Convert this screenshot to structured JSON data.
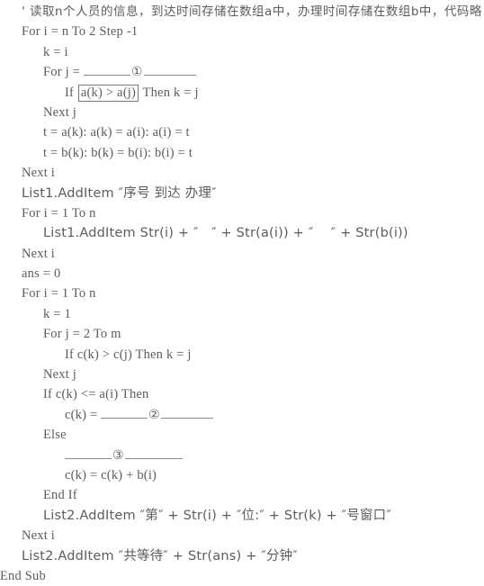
{
  "document": {
    "kind": "vb-pseudocode-listing",
    "language": "Visual Basic",
    "background_color": "#ffffff",
    "text_color": "#5c5c5c",
    "box_border_color": "#7a7a7a",
    "blank_rule_color": "#8a8a8a"
  },
  "lines": [
    {
      "id": "l1",
      "indent": 0,
      "text": "' 读取n个人员的信息，到达时间存储在数组a中，办理时间存储在数组b中，代码略"
    },
    {
      "id": "l2",
      "indent": 0,
      "text": "For i = n To 2 Step -1"
    },
    {
      "id": "l3",
      "indent": 1,
      "text": "k = i"
    },
    {
      "id": "l4",
      "indent": 1,
      "pre": "For j = ",
      "blank": "①",
      "post": ""
    },
    {
      "id": "l5",
      "indent": 2,
      "pre": "If ",
      "boxed": "a(k) > a(j)",
      "post": " Then k = j"
    },
    {
      "id": "l6",
      "indent": 1,
      "text": "Next j"
    },
    {
      "id": "l7",
      "indent": 1,
      "text": "t = a(k): a(k) = a(i): a(i) = t"
    },
    {
      "id": "l8",
      "indent": 1,
      "text": "t = b(k): b(k) = b(i): b(i) = t"
    },
    {
      "id": "l9",
      "indent": 0,
      "text": "Next i"
    },
    {
      "id": "l10",
      "indent": 0,
      "text": "List1.AddItem ″序号 到达 办理″"
    },
    {
      "id": "l11",
      "indent": 0,
      "text": "For i = 1 To n"
    },
    {
      "id": "l12",
      "indent": 1,
      "text": "List1.AddItem Str(i) + ″   ″ + Str(a(i)) + ″    ″ + Str(b(i))"
    },
    {
      "id": "l13",
      "indent": 0,
      "text": "Next i"
    },
    {
      "id": "l14",
      "indent": 0,
      "text": "ans = 0"
    },
    {
      "id": "l15",
      "indent": 0,
      "text": "For i = 1 To n"
    },
    {
      "id": "l16",
      "indent": 1,
      "text": "k = 1"
    },
    {
      "id": "l17",
      "indent": 1,
      "text": "For j = 2 To m"
    },
    {
      "id": "l18",
      "indent": 2,
      "text": "If c(k) > c(j) Then k = j"
    },
    {
      "id": "l19",
      "indent": 1,
      "text": "Next j"
    },
    {
      "id": "l20",
      "indent": 1,
      "text": "If c(k) <= a(i) Then"
    },
    {
      "id": "l21",
      "indent": 2,
      "pre": "c(k) = ",
      "blank": "②",
      "post": ""
    },
    {
      "id": "l22",
      "indent": 1,
      "text": "Else"
    },
    {
      "id": "l23",
      "indent": 2,
      "pre": "",
      "blank": "③",
      "post": ""
    },
    {
      "id": "l24",
      "indent": 2,
      "text": "c(k) = c(k) + b(i)"
    },
    {
      "id": "l25",
      "indent": 1,
      "text": "End If"
    },
    {
      "id": "l26",
      "indent": 1,
      "text": "List2.AddItem ″第″ + Str(i) + ″位:″ + Str(k) + ″号窗口″"
    },
    {
      "id": "l27",
      "indent": 0,
      "text": "Next i"
    },
    {
      "id": "l28",
      "indent": 0,
      "text": "List2.AddItem ″共等待″ + Str(ans) + ″分钟″"
    },
    {
      "id": "l29",
      "indent": -1,
      "text": "End Sub"
    }
  ],
  "blanks": [
    {
      "marker": "①",
      "line_id": "l4",
      "prefix": "For j = "
    },
    {
      "marker": "②",
      "line_id": "l21",
      "prefix": "c(k) = "
    },
    {
      "marker": "③",
      "line_id": "l23",
      "prefix": ""
    }
  ],
  "boxed_expressions": [
    {
      "marker": "box-1",
      "line_id": "l5",
      "text": "a(k) > a(j)"
    }
  ]
}
